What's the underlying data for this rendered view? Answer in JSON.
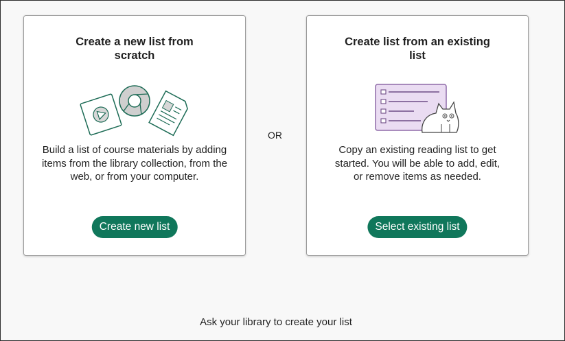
{
  "cards": [
    {
      "title": "Create a new list from scratch",
      "description": "Build a list of course materials by adding items from the library collection, from the web, or from your computer.",
      "button_label": "Create new list"
    },
    {
      "title": "Create list from an existing list",
      "description": "Copy an existing reading list to get started. You will be able to add, edit, or remove items as needed.",
      "button_label": "Select existing list"
    }
  ],
  "separator_text": "OR",
  "footer_link": "Ask your library to create your list",
  "colors": {
    "button_bg": "#10775b",
    "illustration_green": "#1c6b55",
    "illustration_purple": "#8e6aa8"
  },
  "icons": [
    "video-file-icon",
    "web-browser-icon",
    "document-file-icon",
    "reading-list-icon",
    "cat-illustration"
  ]
}
